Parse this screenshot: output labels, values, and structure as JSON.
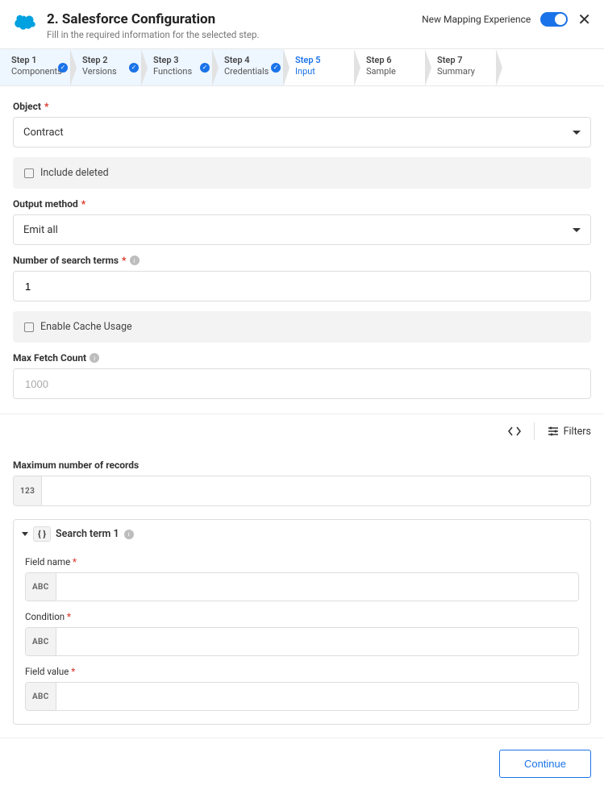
{
  "header": {
    "title": "2. Salesforce Configuration",
    "subtitle": "Fill in the required information for the selected step.",
    "toggle_label": "New Mapping Experience"
  },
  "steps": [
    {
      "label": "Step 1",
      "name": "Components",
      "state": "completed"
    },
    {
      "label": "Step 2",
      "name": "Versions",
      "state": "completed"
    },
    {
      "label": "Step 3",
      "name": "Functions",
      "state": "completed"
    },
    {
      "label": "Step 4",
      "name": "Credentials",
      "state": "completed"
    },
    {
      "label": "Step 5",
      "name": "Input",
      "state": "active"
    },
    {
      "label": "Step 6",
      "name": "Sample",
      "state": "upcoming"
    },
    {
      "label": "Step 7",
      "name": "Summary",
      "state": "upcoming"
    }
  ],
  "form": {
    "object_label": "Object",
    "object_value": "Contract",
    "include_deleted_label": "Include deleted",
    "output_method_label": "Output method",
    "output_method_value": "Emit all",
    "search_terms_label": "Number of search terms",
    "search_terms_value": "1",
    "enable_cache_label": "Enable Cache Usage",
    "max_fetch_label": "Max Fetch Count",
    "max_fetch_value": "1000"
  },
  "tools": {
    "filters_label": "Filters"
  },
  "records": {
    "label": "Maximum number of records",
    "type_badge": "123",
    "value": ""
  },
  "search_term": {
    "title": "Search term 1",
    "field_name_label": "Field name",
    "condition_label": "Condition",
    "field_value_label": "Field value",
    "type_badge": "ABC"
  },
  "footer": {
    "continue_label": "Continue"
  }
}
